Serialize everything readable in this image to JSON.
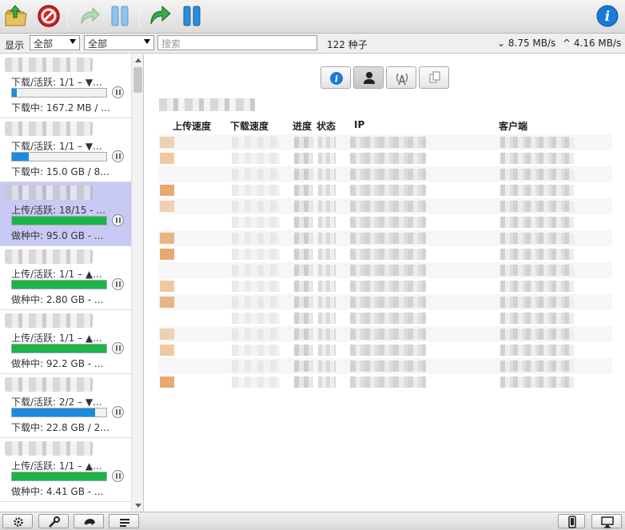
{
  "toolbar": {
    "buttons": [
      {
        "name": "open-torrent-icon",
        "color": "#3a9a3a"
      },
      {
        "name": "remove-torrent-icon",
        "color": "#d61a1a"
      },
      {
        "name": "resume-torrent-icon",
        "color": "#9ccc9c"
      },
      {
        "name": "pause-torrent-icon",
        "color": "#7cb8e8"
      },
      {
        "name": "resume-all-icon",
        "color": "#3a9a3a"
      },
      {
        "name": "pause-all-icon",
        "color": "#2a8ad8"
      },
      {
        "name": "inspector-info-icon",
        "color": "#1a78d8"
      }
    ]
  },
  "filterbar": {
    "show_label": "显示",
    "status_filter": "全部",
    "tracker_filter": "全部",
    "search_placeholder": "搜索",
    "torrent_count": "122 种子",
    "download_speed": "8.75 MB/s",
    "upload_speed": "4.16 MB/s"
  },
  "torrents": [
    {
      "status": "下载/活跃: 1/1 – ▼...",
      "info": "下载中: 167.2 MB / ...",
      "progress": 0.05,
      "color": "blue",
      "selected": false
    },
    {
      "status": "下载/活跃: 1/1 – ▼...",
      "info": "下载中: 15.0 GB / 8...",
      "progress": 0.18,
      "color": "blue",
      "selected": false
    },
    {
      "status": "上传/活跃: 18/15 - ...",
      "info": "做种中: 95.0 GB - ...",
      "progress": 1.0,
      "color": "green",
      "selected": true
    },
    {
      "status": "上传/活跃: 1/1 – ▲...",
      "info": "做种中: 2.80 GB - ...",
      "progress": 1.0,
      "color": "green",
      "selected": false
    },
    {
      "status": "上传/活跃: 1/1 – ▲...",
      "info": "做种中: 92.2 GB - ...",
      "progress": 1.0,
      "color": "green",
      "selected": false
    },
    {
      "status": "下载/活跃: 2/2 – ▼...",
      "info": "下载中: 22.8 GB / 2...",
      "progress": 0.88,
      "color": "blue",
      "selected": false
    },
    {
      "status": "上传/活跃: 1/1 – ▲...",
      "info": "做种中: 4.41 GB - ...",
      "progress": 1.0,
      "color": "green",
      "selected": false
    }
  ],
  "details": {
    "tabs": [
      "info-tab-icon",
      "peers-tab-icon",
      "trackers-tab-icon",
      "files-tab-icon"
    ],
    "active_tab": 1,
    "columns": {
      "upload_speed": "上传速度",
      "download_speed": "下载速度",
      "progress": "进度",
      "status": "状态",
      "ip": "IP",
      "client": "客户端"
    },
    "peer_row_count": 16
  },
  "bottombar": {
    "left_buttons": [
      "settings-icon",
      "preferences-wrench-icon",
      "turtle-speed-icon",
      "list-options-icon"
    ],
    "right_buttons": [
      "compact-view-icon",
      "desktop-view-icon"
    ]
  }
}
